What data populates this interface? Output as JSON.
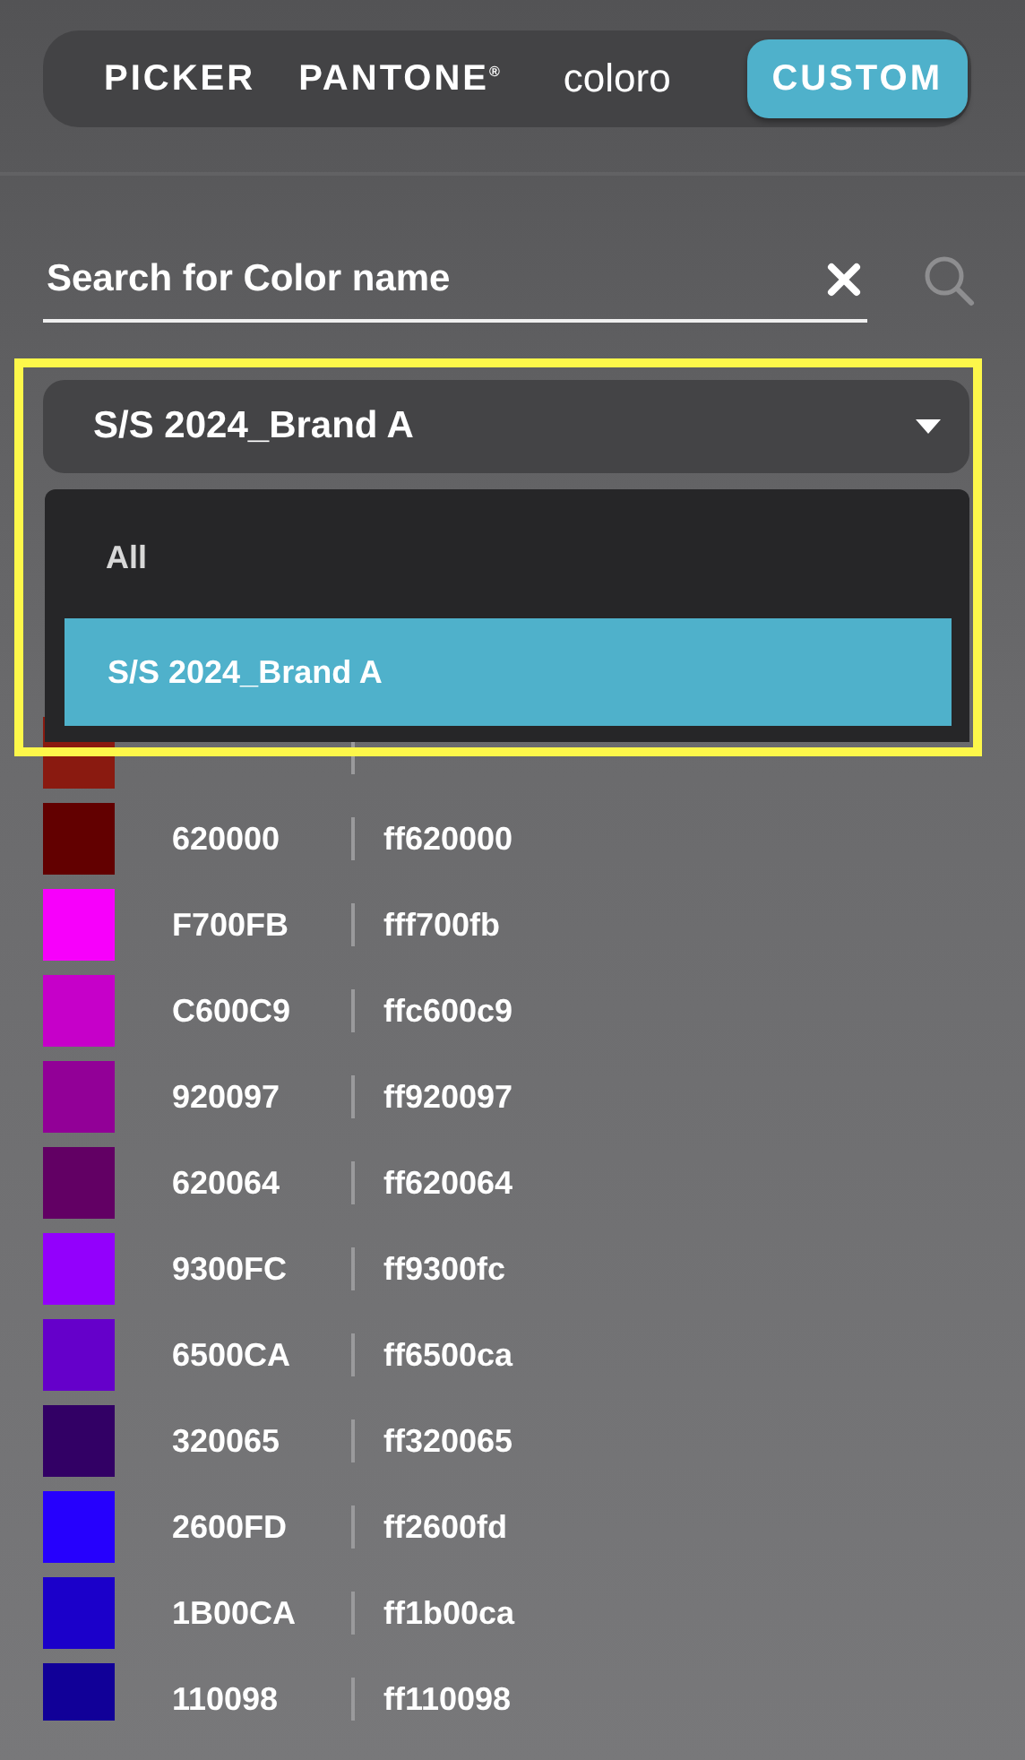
{
  "tabs": [
    {
      "label": "PICKER",
      "kind": "text",
      "selected": false
    },
    {
      "label": "PANTONE$^{®}$",
      "kind": "text",
      "selected": false
    },
    {
      "label": "coloro",
      "kind": "logo",
      "selected": false
    },
    {
      "label": "CUSTOM",
      "kind": "text",
      "selected": true
    }
  ],
  "search": {
    "placeholder": "Search for Color name"
  },
  "dropdown": {
    "value": "S/S 2024_Brand A",
    "expanded": true,
    "options": [
      {
        "label": "All",
        "selected": false
      },
      {
        "label": "S/S 2024_Brand A",
        "selected": true
      }
    ]
  },
  "colors": [
    {
      "color": "#8a1a10"
    },
    {
      "color": "#620000",
      "code": "620000",
      "hex": "ff620000"
    },
    {
      "color": "#f700fb",
      "code": "F700FB",
      "hex": "fff700fb"
    },
    {
      "color": "#c600c9",
      "code": "C600C9",
      "hex": "ffc600c9"
    },
    {
      "color": "#920097",
      "code": "920097",
      "hex": "ff920097"
    },
    {
      "color": "#620064",
      "code": "620064",
      "hex": "ff620064"
    },
    {
      "color": "#9300fc",
      "code": "9300FC",
      "hex": "ff9300fc"
    },
    {
      "color": "#6500ca",
      "code": "6500CA",
      "hex": "ff6500ca"
    },
    {
      "color": "#320065",
      "code": "320065",
      "hex": "ff320065"
    },
    {
      "color": "#2600fd",
      "code": "2600FD",
      "hex": "ff2600fd"
    },
    {
      "color": "#1b00ca",
      "code": "1B00CA",
      "hex": "ff1b00ca"
    },
    {
      "color": "#110098",
      "code": "110098",
      "hex": "ff110098"
    }
  ]
}
